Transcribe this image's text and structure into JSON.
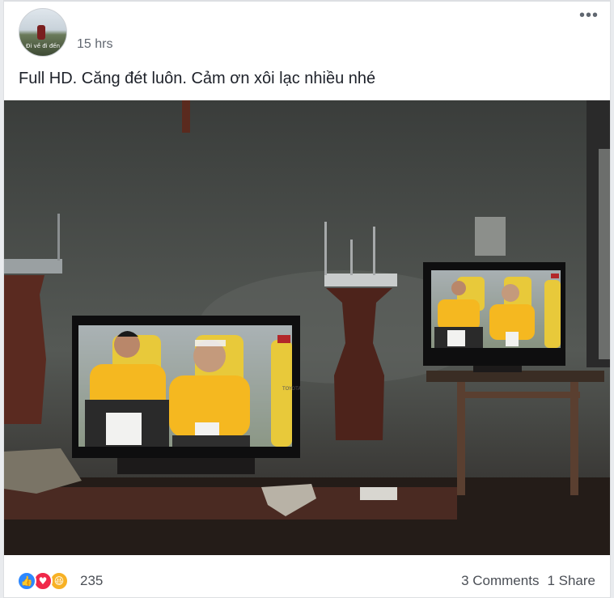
{
  "post": {
    "timestamp": "15 hrs",
    "text": "Full HD. Căng đét luôn. Cảm ơn xôi lạc nhiều nhé",
    "avatar_caption": "Đi về đi đến"
  },
  "photo": {
    "tv_left_badge": "TOYOTA"
  },
  "footer": {
    "reaction_icons": [
      "like-icon",
      "love-icon",
      "haha-icon"
    ],
    "reaction_count": "235",
    "comments": "3 Comments",
    "shares": "1 Share"
  },
  "colors": {
    "like": "#2d88ff",
    "love": "#f0284a",
    "haha": "#f7b125",
    "jersey": "#f5b820",
    "seat": "#e8c93a"
  }
}
